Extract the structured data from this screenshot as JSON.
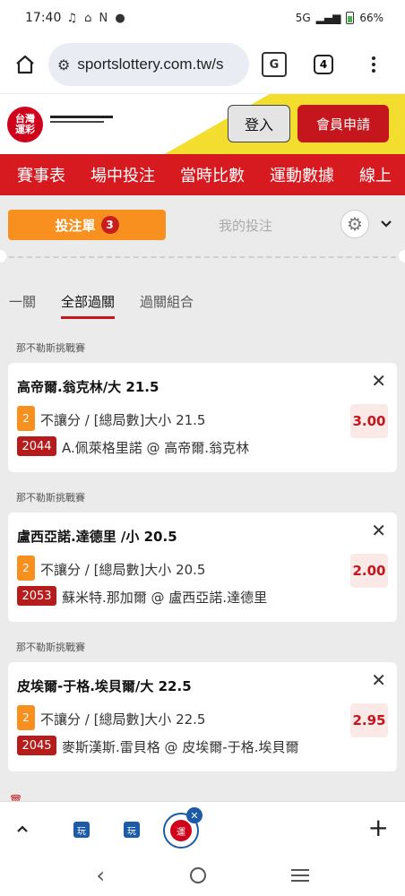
{
  "status_bar": {
    "time": "17:40",
    "network": "5G",
    "battery": "66%"
  },
  "browser": {
    "url": "sportslottery.com.tw/s",
    "tab_count": "4"
  },
  "site": {
    "logo_text": "台灣運彩",
    "login_label": "登入",
    "register_label": "會員申請"
  },
  "nav": {
    "items": [
      {
        "label": "賽事表"
      },
      {
        "label": "場中投注"
      },
      {
        "label": "當時比數"
      },
      {
        "label": "運動數據"
      },
      {
        "label": "線上"
      }
    ]
  },
  "slip": {
    "slip_tab_label": "投注單",
    "slip_count": "3",
    "my_bets_label": "我的投注",
    "subtabs": [
      {
        "label": "一關"
      },
      {
        "label": "全部過關"
      },
      {
        "label": "過關組合"
      }
    ],
    "bets": [
      {
        "league": "那不勒斯挑戰賽",
        "title": "高帝爾.翁克林/大 21.5",
        "num": "2",
        "market": "不讓分 / [總局數]大小 21.5",
        "odds": "3.00",
        "code": "2044",
        "match": "A.佩萊格里諾 @ 高帝爾.翁克林"
      },
      {
        "league": "那不勒斯挑戰賽",
        "title": "盧西亞諾.達德里 /小 20.5",
        "num": "2",
        "market": "不讓分 / [總局數]大小 20.5",
        "odds": "2.00",
        "code": "2053",
        "match": "蘇米特.那加爾 @ 盧西亞諾.達德里"
      },
      {
        "league": "那不勒斯挑戰賽",
        "title": "皮埃爾-于格.埃貝爾/大 22.5",
        "num": "2",
        "market": "不讓分 / [總局數]大小 22.5",
        "odds": "2.95",
        "code": "2045",
        "match": "麥斯漢斯.雷貝格 @ 皮埃爾-于格.埃貝爾"
      }
    ]
  },
  "colors": {
    "brand_red": "#d71920",
    "accent_orange": "#f7901e",
    "stripe_yellow": "#f3dd2f"
  }
}
